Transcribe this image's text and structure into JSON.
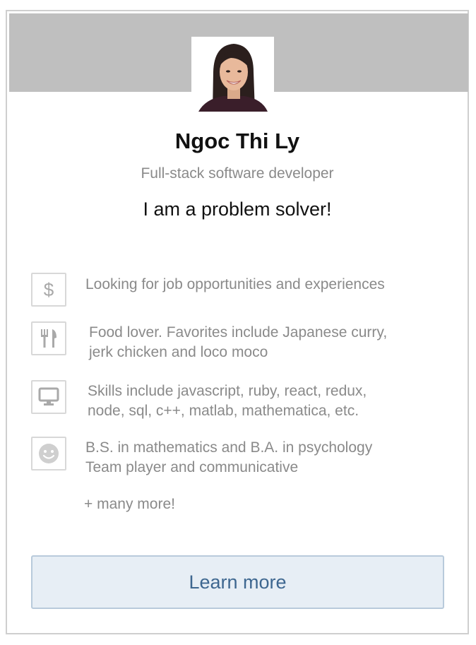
{
  "profile": {
    "name": "Ngoc Thi Ly",
    "role": "Full-stack software developer",
    "tagline": "I am a problem solver!"
  },
  "items": [
    {
      "icon": "dollar-icon",
      "text": "Looking for job opportunities and experiences"
    },
    {
      "icon": "fork-knife-icon",
      "text": "Food lover. Favorites include Japanese curry,\njerk chicken and loco moco"
    },
    {
      "icon": "monitor-icon",
      "text": "Skills include javascript, ruby, react, redux,\nnode, sql, c++, matlab, mathematica, etc."
    },
    {
      "icon": "smiley-icon",
      "text": "B.S. in mathematics and B.A. in psychology\nTeam player and communicative"
    }
  ],
  "more_text": "+ many more!",
  "learn_more_label": "Learn more",
  "colors": {
    "banner": "#bfbfbf",
    "muted_text": "#8a8a8a",
    "button_bg": "#e7eef5",
    "button_text": "#3e6790"
  }
}
